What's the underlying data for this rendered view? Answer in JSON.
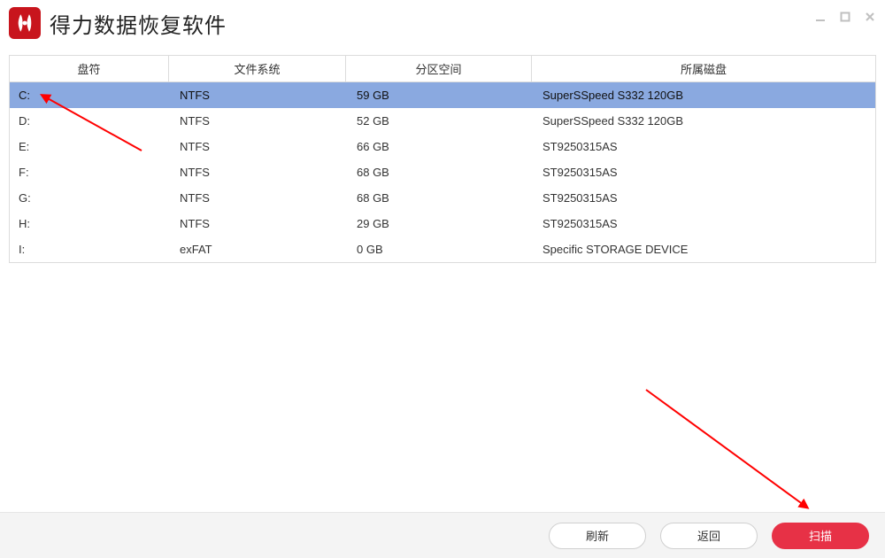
{
  "header": {
    "title": "得力数据恢复软件"
  },
  "colors": {
    "accent": "#e73146",
    "selection": "#8aa9e0",
    "logo": "#c8151d"
  },
  "table": {
    "headers": {
      "drive": "盘符",
      "filesystem": "文件系统",
      "size": "分区空间",
      "disk": "所属磁盘"
    },
    "selected_index": 0,
    "rows": [
      {
        "drive": "C:",
        "filesystem": "NTFS",
        "size": "59 GB",
        "disk": "SuperSSpeed S332 120GB"
      },
      {
        "drive": "D:",
        "filesystem": "NTFS",
        "size": "52 GB",
        "disk": "SuperSSpeed S332 120GB"
      },
      {
        "drive": "E:",
        "filesystem": "NTFS",
        "size": "66 GB",
        "disk": "ST9250315AS"
      },
      {
        "drive": "F:",
        "filesystem": "NTFS",
        "size": "68 GB",
        "disk": "ST9250315AS"
      },
      {
        "drive": "G:",
        "filesystem": "NTFS",
        "size": "68 GB",
        "disk": "ST9250315AS"
      },
      {
        "drive": "H:",
        "filesystem": "NTFS",
        "size": "29 GB",
        "disk": "ST9250315AS"
      },
      {
        "drive": "I:",
        "filesystem": "exFAT",
        "size": "0 GB",
        "disk": "Specific STORAGE DEVICE"
      }
    ]
  },
  "footer": {
    "refresh": "刷新",
    "back": "返回",
    "scan": "扫描"
  }
}
